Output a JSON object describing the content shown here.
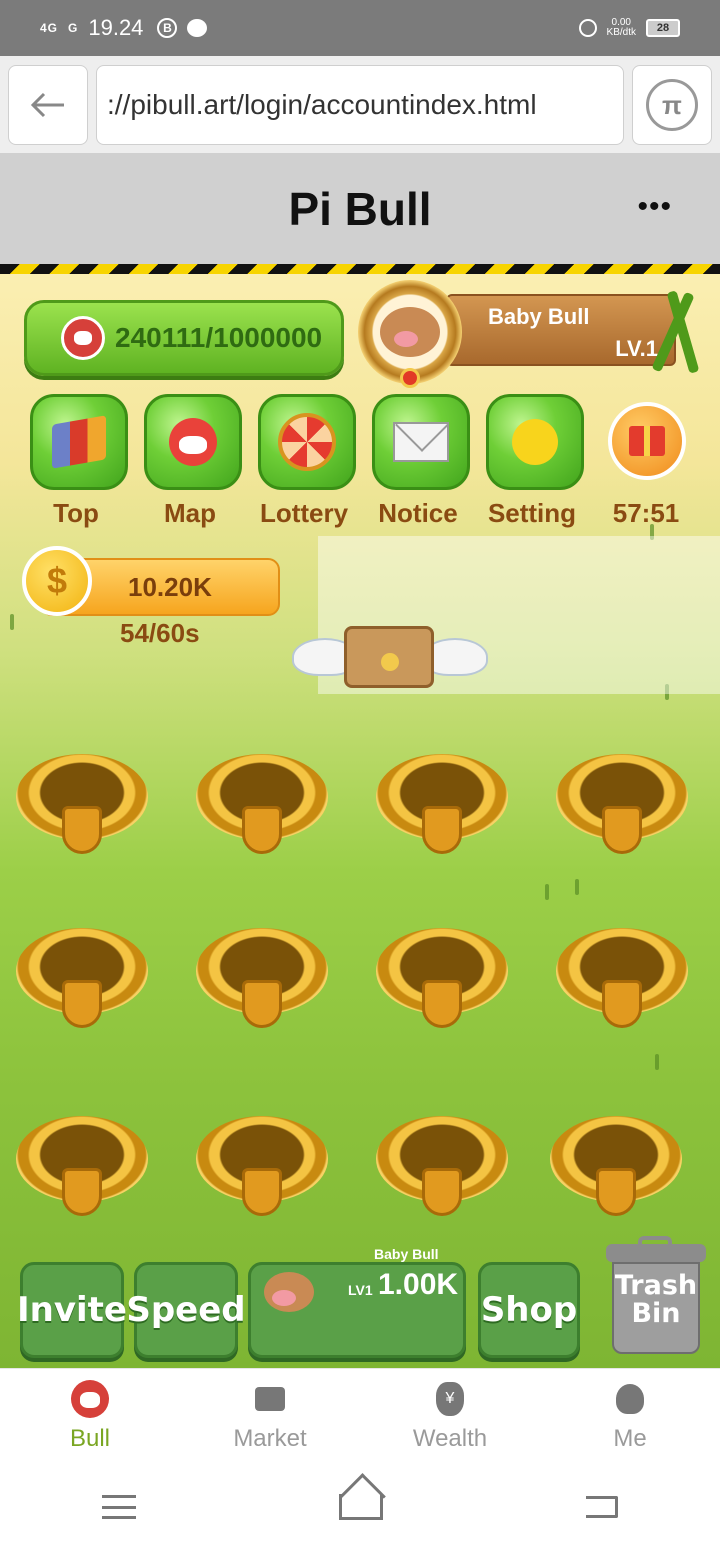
{
  "status_bar": {
    "signal1": "4G",
    "signal2": "G",
    "time": "19.24",
    "badge": "B",
    "net_speed": "0.00",
    "net_unit": "KB/dtk",
    "battery": "28"
  },
  "browser": {
    "url": "://pibull.art/login/accountindex.html",
    "back_icon": "arrow-left-icon",
    "pi_icon": "pi-logo-icon",
    "pi_symbol": "π"
  },
  "header": {
    "title": "Pi Bull",
    "more": "•••"
  },
  "game": {
    "progress": "240111/1000000",
    "player": {
      "name": "Baby Bull",
      "level": "LV.1"
    },
    "menu": [
      {
        "label": "Top",
        "icon": "ranking-cards-icon"
      },
      {
        "label": "Map",
        "icon": "bull-map-icon"
      },
      {
        "label": "Lottery",
        "icon": "wheel-icon"
      },
      {
        "label": "Notice",
        "icon": "envelope-icon"
      },
      {
        "label": "Setting",
        "icon": "gear-icon"
      }
    ],
    "gift_timer": "57:51",
    "coins": {
      "symbol": "$",
      "value": "10.20K",
      "cooldown": "54/60s"
    },
    "slots_count": 12,
    "buttons": {
      "invite": "Invite",
      "speed": "Speed",
      "buy": {
        "name": "Baby Bull",
        "level": "LV1",
        "price": "1.00K"
      },
      "shop": "Shop",
      "trash_line1": "Trash",
      "trash_line2": "Bin"
    }
  },
  "tabbar": [
    {
      "label": "Bull",
      "icon": "bull-icon",
      "active": true
    },
    {
      "label": "Market",
      "icon": "store-icon",
      "active": false
    },
    {
      "label": "Wealth",
      "icon": "money-bag-icon",
      "active": false,
      "glyph": "¥"
    },
    {
      "label": "Me",
      "icon": "ghost-face-icon",
      "active": false
    }
  ],
  "colors": {
    "accent_green": "#7aa623",
    "status_bar": "#7b7b7b",
    "header_bg": "#d0d0d0"
  }
}
